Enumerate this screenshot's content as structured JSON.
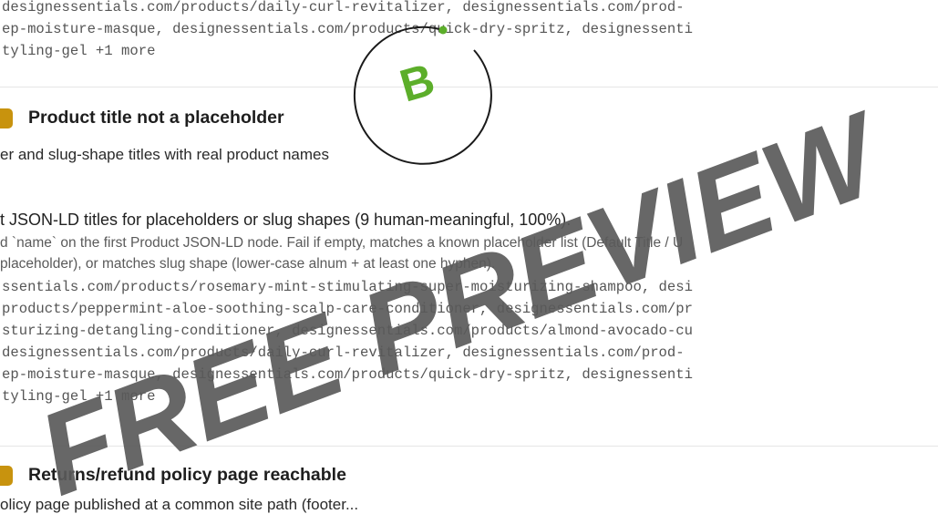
{
  "top_urls": {
    "line1": "designessentials.com/products/daily-curl-revitalizer, designessentials.com/prod-",
    "line2": "ep-moisture-masque, designessentials.com/products/quick-dry-spritz, designessenti",
    "line3": "tyling-gel +1 more"
  },
  "section1": {
    "title": "Product title not a placeholder",
    "subtitle": "er and slug-shape titles with real product names",
    "check": "t JSON-LD titles for placeholders or slug shapes (9 human-meaningful, 100%).",
    "note1": "d `name` on the first Product JSON-LD node. Fail if empty, matches a known placeholder list (Default Title / U",
    "note2": " placeholder), or matches slug shape (lower-case alnum + at least one hyphen).",
    "urls": [
      "ssentials.com/products/rosemary-mint-stimulating-super-moisturizing-shampoo, desi",
      "products/peppermint-aloe-soothing-scalp-care-conditioner, designessentials.com/pr",
      "sturizing-detangling-conditioner, designessentials.com/products/almond-avocado-cu",
      "designessentials.com/products/daily-curl-revitalizer, designessentials.com/prod-",
      "ep-moisture-masque, designessentials.com/products/quick-dry-spritz, designessenti",
      "tyling-gel +1 more"
    ]
  },
  "section2": {
    "title": "Returns/refund policy page reachable",
    "subtitle": "olicy page published at a common site path (footer..."
  },
  "watermark": {
    "text": "FREE PREVIEW",
    "logo_letter": "B",
    "color": "#5a5a5a",
    "logo_color": "#5cae2a"
  },
  "colors": {
    "badge": "#c8930e"
  }
}
